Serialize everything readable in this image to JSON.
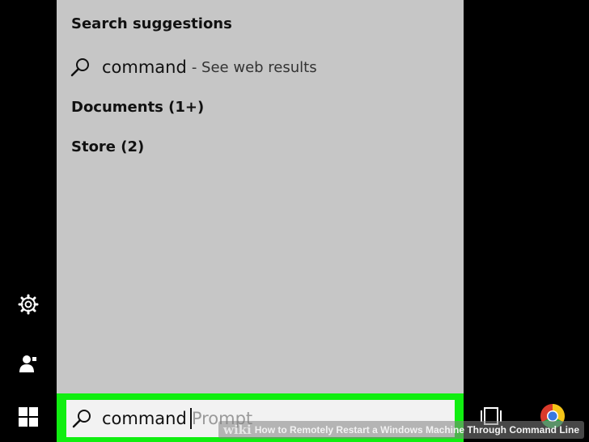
{
  "search_panel": {
    "suggestions_header": "Search suggestions",
    "web_suggestion": {
      "term": "command",
      "suffix": "- See web results"
    },
    "documents_header": "Documents (1+)",
    "store_header": "Store (2)"
  },
  "searchbar": {
    "value": "command",
    "placeholder": "Prompt",
    "highlight_color": "#10ee10"
  },
  "left_rail": {
    "icons": [
      "gear-icon",
      "user-icon",
      "windows-start-icon"
    ]
  },
  "taskbar": {
    "icons": [
      "task-view-icon",
      "chrome-icon"
    ]
  },
  "watermark": {
    "logo": "wiki",
    "title": "How to Remotely Restart a Windows Machine Through Command Line"
  }
}
